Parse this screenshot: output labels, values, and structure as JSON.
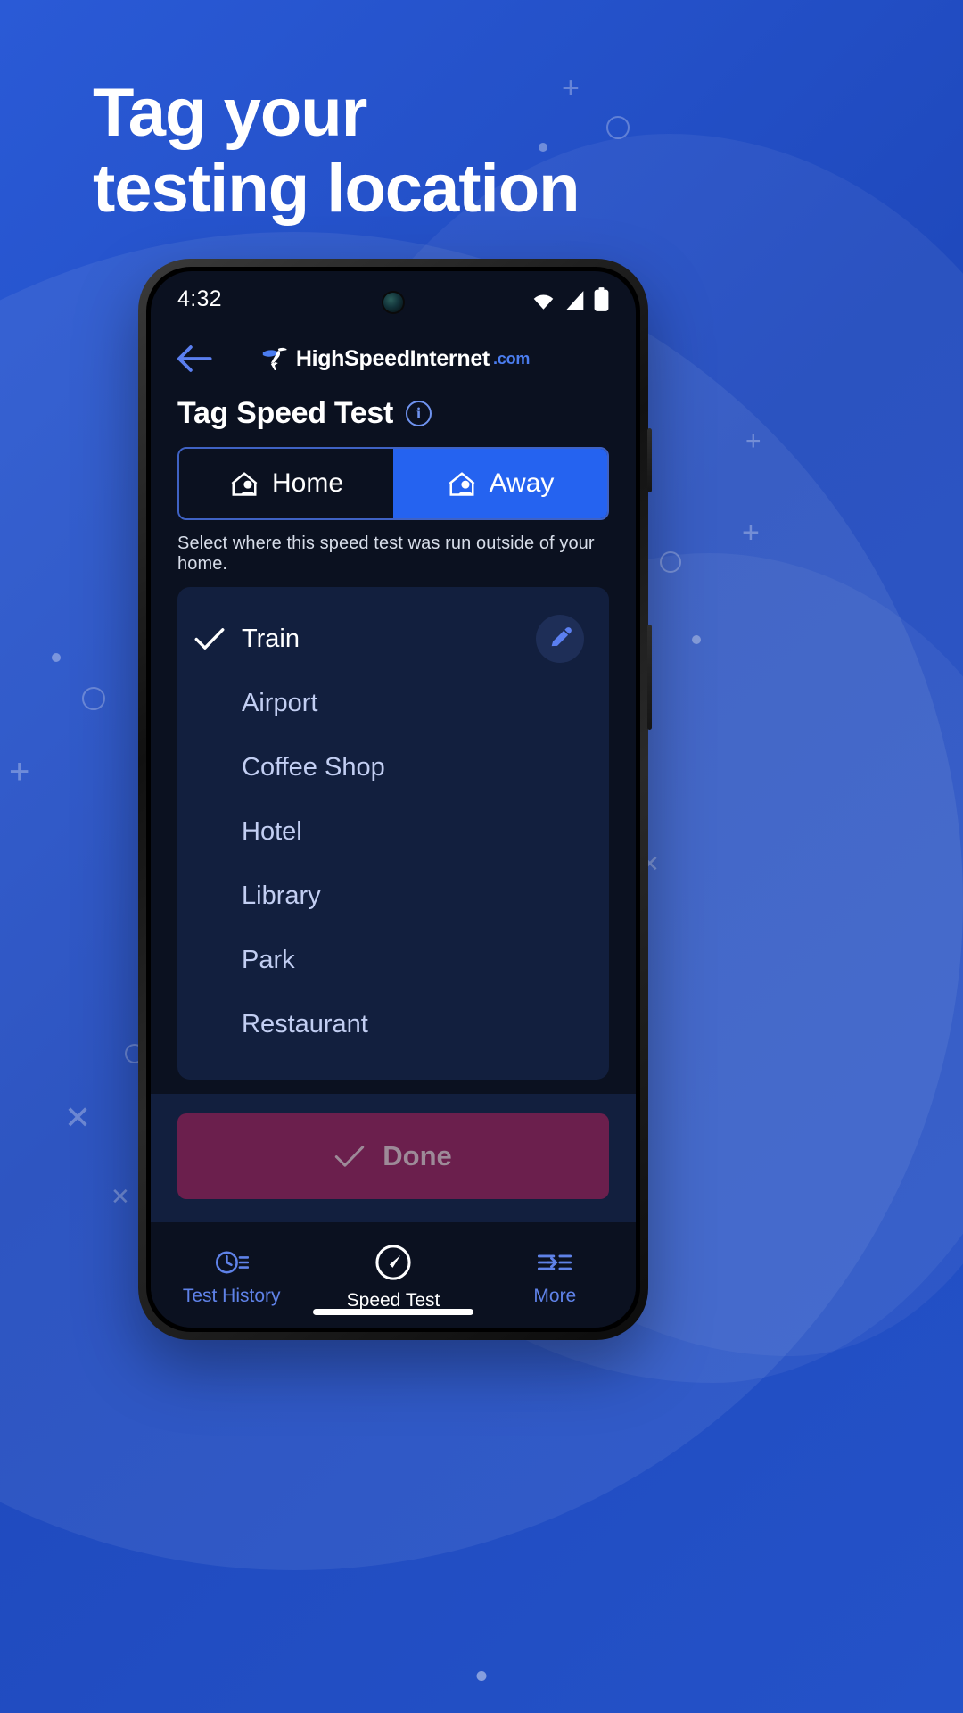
{
  "promo": {
    "headline": "Tag your\ntesting location",
    "background_color": "#2453c9"
  },
  "phone": {
    "status_bar": {
      "time": "4:32",
      "icons": [
        "wifi-icon",
        "cellular-signal-icon",
        "battery-icon"
      ]
    },
    "app_header": {
      "back_label": "back-arrow",
      "brand_name": "HighSpeedInternet",
      "brand_suffix": ".com",
      "brand_accent_color": "#4b7df0"
    },
    "page": {
      "title": "Tag Speed Test",
      "info_glyph": "i",
      "toggle": {
        "options": [
          {
            "label": "Home",
            "active": false
          },
          {
            "label": "Away",
            "active": true
          }
        ],
        "active_color": "#2563f0",
        "border_color": "#3f62c4"
      },
      "helper_text": "Select where this speed test was run outside of your home.",
      "options_card": {
        "background_color": "#121f3e",
        "items": [
          {
            "label": "Train",
            "selected": true,
            "editable": true
          },
          {
            "label": "Airport",
            "selected": false,
            "editable": false
          },
          {
            "label": "Coffee Shop",
            "selected": false,
            "editable": false
          },
          {
            "label": "Hotel",
            "selected": false,
            "editable": false
          },
          {
            "label": "Library",
            "selected": false,
            "editable": false
          },
          {
            "label": "Park",
            "selected": false,
            "editable": false
          },
          {
            "label": "Restaurant",
            "selected": false,
            "editable": false
          }
        ]
      },
      "done_button": {
        "label": "Done",
        "background_color": "#6b1f4d",
        "text_color": "#9d8a98",
        "enabled": false
      }
    },
    "bottom_nav": {
      "items": [
        {
          "label": "Test History",
          "icon": "history-clock-icon",
          "active": false
        },
        {
          "label": "Speed Test",
          "icon": "speedometer-icon",
          "active": true
        },
        {
          "label": "More",
          "icon": "more-list-icon",
          "active": false
        }
      ],
      "active_color": "#ffffff",
      "inactive_color": "#5f82e8"
    }
  }
}
